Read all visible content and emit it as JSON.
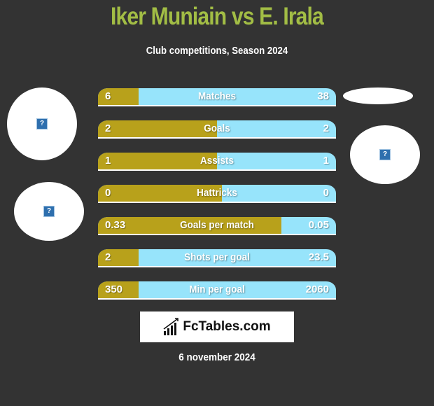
{
  "header": {
    "title": "Iker Muniain vs E. Irala",
    "subtitle": "Club competitions, Season 2024"
  },
  "players": {
    "left": {
      "name": "Iker Muniain",
      "avatar_icon": "broken-image-icon"
    },
    "right": {
      "name": "E. Irala",
      "avatar_icon": "broken-image-icon"
    }
  },
  "colors": {
    "left_bar": "#b8a11b",
    "right_bar": "#97e4fb",
    "title": "#a2bd45",
    "background": "#333333"
  },
  "chart_data": {
    "type": "bar",
    "title": "Iker Muniain vs E. Irala",
    "subtitle": "Club competitions, Season 2024",
    "categories": [
      "Matches",
      "Goals",
      "Assists",
      "Hattricks",
      "Goals per match",
      "Shots per goal",
      "Min per goal"
    ],
    "series": [
      {
        "name": "Iker Muniain",
        "values": [
          6,
          2,
          1,
          0,
          0.33,
          2,
          350
        ],
        "display": [
          "6",
          "2",
          "1",
          "0",
          "0.33",
          "2",
          "350"
        ]
      },
      {
        "name": "E. Irala",
        "values": [
          38,
          2,
          1,
          0,
          0.05,
          23.5,
          2060
        ],
        "display": [
          "38",
          "2",
          "1",
          "0",
          "0.05",
          "23.5",
          "2060"
        ]
      }
    ],
    "left_share": [
      0.17,
      0.5,
      0.5,
      0.52,
      0.77,
      0.17,
      0.17
    ]
  },
  "footer": {
    "logo_text": "FcTables.com",
    "date": "6 november 2024"
  }
}
